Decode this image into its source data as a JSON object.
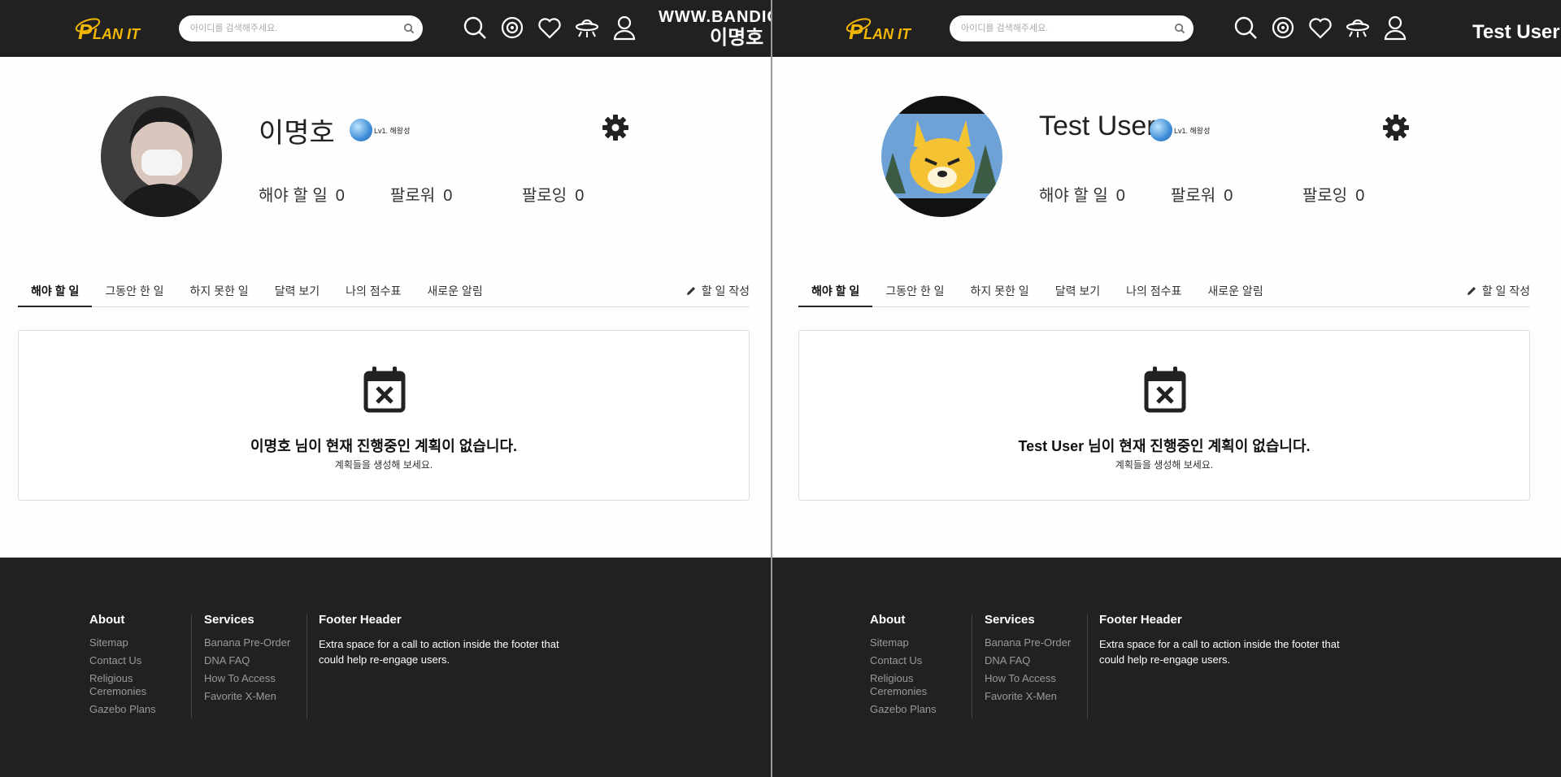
{
  "watermark": "WWW.BANDICAM.COM",
  "panes": [
    {
      "logo_text": "PLAN IT",
      "search_placeholder": "아이디를 검색해주세요.",
      "nav_user": "이명호",
      "profile": {
        "name": "이명호",
        "level": "Lv1. 해왕성"
      },
      "stats": [
        {
          "label": "해야 할 일",
          "value": "0"
        },
        {
          "label": "팔로워",
          "value": "0"
        },
        {
          "label": "팔로잉",
          "value": "0"
        }
      ],
      "tabs": [
        "해야 할 일",
        "그동안 한 일",
        "하지 못한 일",
        "달력 보기",
        "나의 점수표",
        "새로운 알림"
      ],
      "write_label": "할 일 작성",
      "empty_title": "이명호 님이 현재 진행중인 계획이 없습니다.",
      "empty_sub": "계획들을 생성해 보세요."
    },
    {
      "logo_text": "PLAN IT",
      "search_placeholder": "아이디를 검색해주세요.",
      "nav_user": "Test User",
      "profile": {
        "name": "Test User",
        "level": "Lv1. 해왕성"
      },
      "stats": [
        {
          "label": "해야 할 일",
          "value": "0"
        },
        {
          "label": "팔로워",
          "value": "0"
        },
        {
          "label": "팔로잉",
          "value": "0"
        }
      ],
      "tabs": [
        "해야 할 일",
        "그동안 한 일",
        "하지 못한 일",
        "달력 보기",
        "나의 점수표",
        "새로운 알림"
      ],
      "write_label": "할 일 작성",
      "empty_title": "Test User 님이 현재 진행중인 계획이 없습니다.",
      "empty_sub": "계획들을 생성해 보세요."
    }
  ],
  "footer": {
    "about": {
      "title": "About",
      "links": [
        "Sitemap",
        "Contact Us",
        "Religious Ceremonies",
        "Gazebo Plans"
      ]
    },
    "services": {
      "title": "Services",
      "links": [
        "Banana Pre-Order",
        "DNA FAQ",
        "How To Access",
        "Favorite X-Men"
      ]
    },
    "extra": {
      "title": "Footer Header",
      "text": "Extra space for a call to action inside the footer that could help re-engage users."
    }
  },
  "icons": [
    "search-icon",
    "planet-icon",
    "heart-icon",
    "ufo-icon",
    "user-icon",
    "gear-icon",
    "pencil-icon",
    "calendar-x-icon"
  ],
  "colors": {
    "navbar": "#212121",
    "logo_yellow": "#f2b705",
    "level_planet": "#3f8fd8"
  }
}
